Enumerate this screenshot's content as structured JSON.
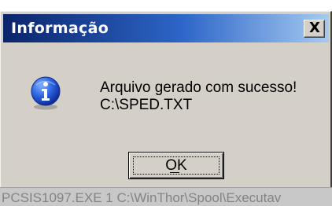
{
  "dialog": {
    "title": "Informação",
    "close_glyph": "X",
    "icon": "info-icon",
    "message_lines": [
      "Arquivo gerado com sucesso!",
      "C:\\SPED.TXT"
    ],
    "ok_button": {
      "label": "OK",
      "mnemonic": "O"
    }
  },
  "statusbar": {
    "text": "PCSIS1097.EXE 1 C:\\WinThor\\Spool\\Executav"
  },
  "colors": {
    "titlebar_start": "#0a246a",
    "titlebar_end": "#a6caf0",
    "dialog_face": "#d4d0c8",
    "info_icon_fill": "#1c4fd0",
    "status_text": "#848484"
  }
}
